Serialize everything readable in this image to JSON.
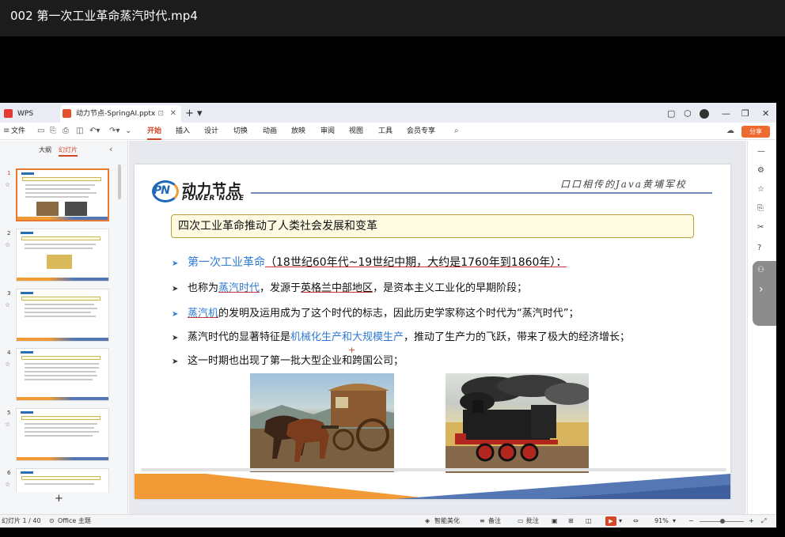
{
  "video": {
    "title": "002 第一次工业革命蒸汽时代.mp4"
  },
  "tabs": [
    {
      "label": "WPS Office"
    },
    {
      "label": "动力节点-SpringAI.pptx"
    }
  ],
  "menu": {
    "file": "文件",
    "items": [
      "开始",
      "插入",
      "设计",
      "切换",
      "动画",
      "放映",
      "审阅",
      "视图",
      "工具",
      "会员专享"
    ],
    "active": "开始",
    "share": "分享"
  },
  "left_panel": {
    "tabs": [
      "大纲",
      "幻灯片"
    ],
    "active_tab": "幻灯片",
    "slide_numbers": [
      "1",
      "2",
      "3",
      "4",
      "5",
      "6"
    ]
  },
  "slide": {
    "logo_cn": "动力节点",
    "logo_en": "POWER NODE",
    "logo_mark": "PN",
    "slogan": "口口相传的Java黄埔军校",
    "title": "四次工业革命推动了人类社会发展和变革",
    "b1": {
      "a": "第一次工业革命",
      "b": "（18世纪60年代~19世纪中期，大约是1760年到1860年）："
    },
    "b2": {
      "a": "也称为",
      "b": "蒸汽时代",
      "c": "，发源于",
      "d": "英格兰中部地区",
      "e": "，是资本主义工业化的早期阶段；"
    },
    "b3": {
      "a": "蒸汽机",
      "b": "的发明及运用成为了这个时代的标志，因此历史学家称这个时代为“蒸汽时代”；"
    },
    "b4": {
      "a": "蒸汽时代的显著特征是",
      "b": "机械化生产和大规模生产",
      "c": "，推动了生产力的飞跃，带来了极大的经济增长；"
    },
    "b5": "这一时期也出现了第一批大型企业和跨国公司；"
  },
  "status": {
    "slide_counter": "幻灯片 1 / 40",
    "theme": "Office 主题",
    "smart": "智能美化",
    "notes": "备注",
    "comments": "批注",
    "zoom": "91%"
  },
  "colors": {
    "accent": "#d24726",
    "blue_text": "#2f7bd2",
    "orange": "#f29a36",
    "navy": "#5577b4"
  }
}
